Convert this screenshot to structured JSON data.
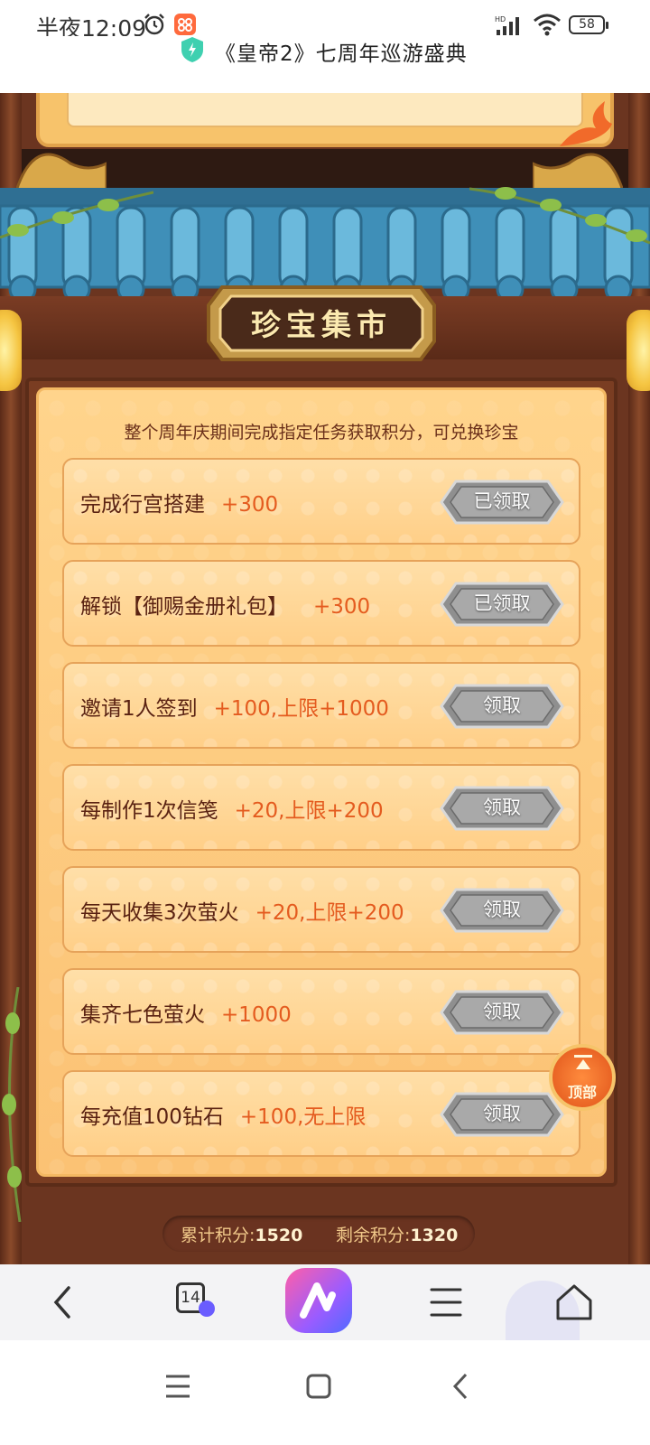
{
  "status_bar": {
    "time": "半夜12:09",
    "network_type": "HD",
    "battery": "58"
  },
  "page": {
    "title": "《皇帝2》七周年巡游盛典"
  },
  "market": {
    "title": "珍宝集市",
    "description": "整个周年庆期间完成指定任务获取积分，可兑换珍宝",
    "tasks": [
      {
        "name": "完成行宫搭建",
        "points": "+300",
        "button": "已领取"
      },
      {
        "name": "解锁【御赐金册礼包】",
        "points": "+300",
        "button": "已领取"
      },
      {
        "name": "邀请1人签到",
        "points": "+100,上限+1000",
        "button": "领取"
      },
      {
        "name": "每制作1次信笺",
        "points": "+20,上限+200",
        "button": "领取"
      },
      {
        "name": "每天收集3次萤火",
        "points": "+20,上限+200",
        "button": "领取"
      },
      {
        "name": "集齐七色萤火",
        "points": "+1000",
        "button": "领取"
      },
      {
        "name": "每充值100钻石",
        "points": "+100,无上限",
        "button": "领取"
      }
    ],
    "scroll_top_label": "顶部",
    "total_points_label": "累计积分:",
    "total_points_value": "1520",
    "remaining_points_label": "剩余积分:",
    "remaining_points_value": "1320"
  },
  "browser_toolbar": {
    "tab_count": "14",
    "icons": [
      "back-icon",
      "tabs-icon",
      "ai-assistant-icon",
      "menu-icon",
      "home-icon"
    ]
  },
  "colors": {
    "board_bg": "#fbc274",
    "points_text": "#e45b1f",
    "task_text": "#5a2212",
    "wood": "#7a3d22",
    "roof_tile": "#3f8fb8"
  }
}
